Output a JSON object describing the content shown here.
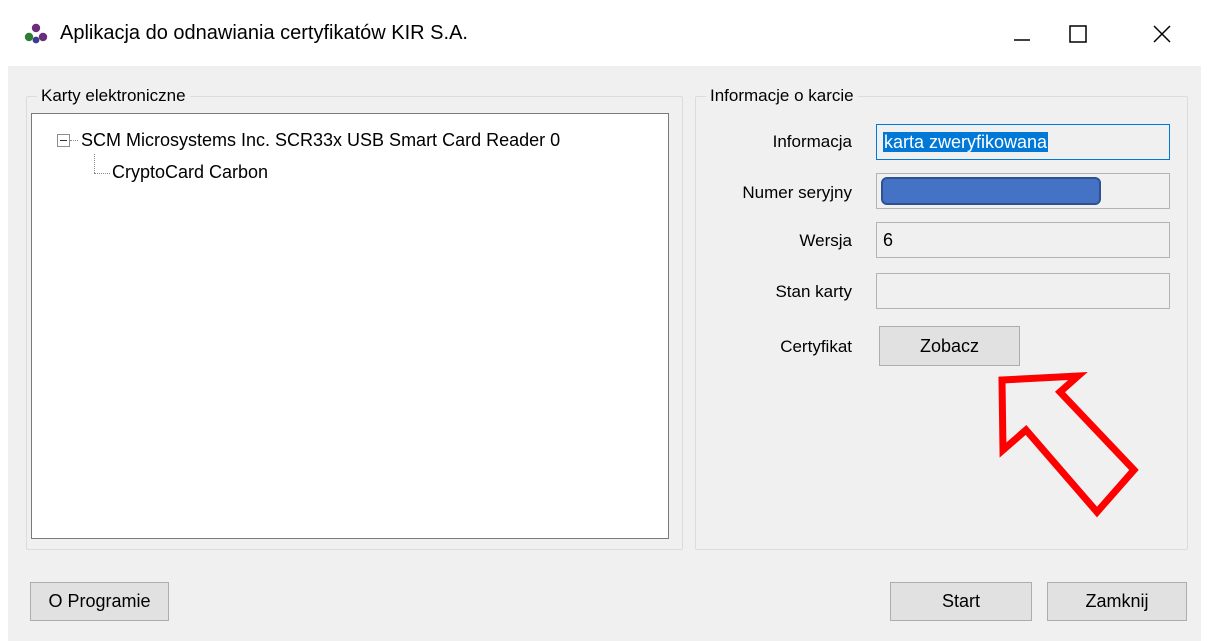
{
  "window": {
    "title": "Aplikacja do odnawiania certyfikatów KIR S.A.",
    "icons": {
      "app": "kir-logo-icon",
      "minimize": "minimize-icon",
      "maximize": "maximize-icon",
      "close": "close-icon"
    }
  },
  "cards_panel": {
    "title": "Karty elektroniczne",
    "tree": [
      {
        "label": "SCM Microsystems Inc. SCR33x USB Smart Card Reader 0",
        "expanded": true,
        "children": [
          {
            "label": "CryptoCard Carbon"
          }
        ]
      }
    ]
  },
  "info_panel": {
    "title": "Informacje o karcie",
    "fields": {
      "information": {
        "label": "Informacja",
        "value": "karta zweryfikowana"
      },
      "serial_number": {
        "label": "Numer seryjny",
        "value": ""
      },
      "version": {
        "label": "Wersja",
        "value": "6"
      },
      "card_state": {
        "label": "Stan karty",
        "value": ""
      },
      "certificate": {
        "label": "Certyfikat",
        "button": "Zobacz"
      }
    }
  },
  "footer": {
    "about_button": "O Programie",
    "start_button": "Start",
    "close_button": "Zamknij"
  },
  "colors": {
    "selection": "#0078d7",
    "annotation_arrow": "#ff0000",
    "redaction": "#4472c4"
  }
}
